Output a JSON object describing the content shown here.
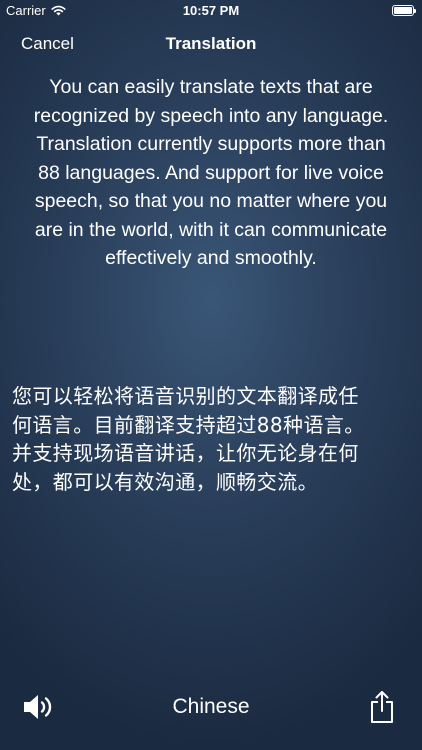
{
  "status_bar": {
    "carrier": "Carrier",
    "time": "10:57 PM"
  },
  "nav": {
    "cancel_label": "Cancel",
    "title": "Translation"
  },
  "source_text": "You can easily translate texts that are\nrecognized by speech into any language.\nTranslation currently supports more than\n88 languages. And support for live voice\nspeech, so that you no matter where you\nare in the world, with it can communicate\neffectively and smoothly.",
  "translated_text": "您可以轻松将语音识别的文本翻译成任\n何语言。目前翻译支持超过88种语言。\n并支持现场语音讲话，让你无论身在何\n处，都可以有效沟通，顺畅交流。",
  "bottom_bar": {
    "language_label": "Chinese",
    "speaker_icon": "speaker-icon",
    "share_icon": "share-icon"
  }
}
